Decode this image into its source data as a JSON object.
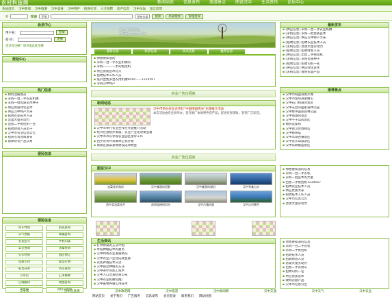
{
  "header": {
    "logo_text": "农村科技网",
    "top_nav": [
      "新闻动态",
      "信息发布",
      "旅游景点",
      "图说汉中",
      "生活资讯",
      "论坛中心"
    ],
    "sub_nav": [
      "本站首页",
      "汉中新闻",
      "汉中旅游",
      "汉中美食",
      "汉中特产",
      "招商引资",
      "人才招聘",
      "房产信息",
      "汉中论坛",
      "留言反馈"
    ]
  },
  "search": {
    "label_keyword": "搜索",
    "select_1": "不限",
    "select_2": "所有分类",
    "search_button": "搜索",
    "advanced_button": "高级搜索",
    "manage_button": "管理登录"
  },
  "login": {
    "title": "会员中心",
    "user_label": "用户名：",
    "pass_label": "密 码：",
    "login_button": "登录",
    "register_button": "注册",
    "note": "还没有注册？请点击此处注册"
  },
  "side_tabs": {
    "label": "帮助中心"
  },
  "left_news": {
    "title": "热门信息",
    "items": [
      "如何注册会员",
      "求购一台二手农业机械",
      "求购一批优质苗木种子",
      "供应优质绿化苗木",
      "供应汉中特产大米",
      "招聘农业技术人员",
      "急需大量劳动力",
      "出售二手拖拉机一台",
      "招聘财会人员若干",
      "汉中市农业信息公告",
      "招商引资项目发布",
      "南郑县农产品交易"
    ]
  },
  "left_links": {
    "title": "便民信息"
  },
  "banner": {
    "caption_1": "汉中市农科站",
    "caption_2": "农民致富的好帮手"
  },
  "main_tabs": [
    "最新信息",
    "供求信息",
    "热点信息",
    "推荐信息"
  ],
  "latest": {
    "items": [
      "你想要知道的",
      "求购一台一手农业机械的",
      "求购一一二一手的拖拉机",
      "供应优质苗木花卉",
      "招聘技术工作人员",
      "低价出售多台农用机械9016——1234567",
      "求购汉中特产",
      "招聘人员若干名"
    ]
  },
  "sep_1": "农业广告位招商",
  "news_box": {
    "title": "新闻动态",
    "more": "more",
    "headline": "汉中市举办农业合作社\"中国田园风光\"主题推介活动",
    "lead": "本次活动由农业局举办，旨在推广本地特色农产品，促进农民增收，受到广泛欢迎。",
    "items": [
      "汉中市举行农业合作社专题推介活动",
      "经济社会稳步发展，农业产业化效果显著",
      "汉中市市长参观农业园区指导工作",
      "西乡县茶叶采摘季正式开始",
      "南郑区蔬菜基地建设成效明显"
    ]
  },
  "right_box": {
    "title": "最新发布",
    "items": [
      "[供应信息] 求购一台二手农业机械",
      "[求购信息] 求购一批优质苗木",
      "[供应信息] 供应汉中特产大米",
      "[招聘信息] 招聘农业技术人员",
      "[求购信息] 急需大量劳动力",
      "[招聘信息] 招聘财会人员",
      "[供应信息] 出售二手拖拉机",
      "[求购信息] 求购优质种子",
      "[招聘信息] 招聘司机一名",
      "[供应信息] 供应绿化苗木",
      "[求购信息] 收购农副产品"
    ]
  },
  "recommend": {
    "title": "推荐景点",
    "items": [
      "汉中市城固县南沙湖",
      "汉中市留坝县紫柏山",
      "汉中石门栈道风景区",
      "汉中天台山国家森林公园",
      "汉中黎坪国家森林公园",
      "汉中南湖风景区",
      "汉中午子山风景区",
      "勉县武侯祠",
      "汉中古汉台博物馆",
      "汉中拜将坛",
      "汉中华阳古镇景区",
      "汉中龙头山旅游区",
      "汉中朱鹮梨园景区"
    ]
  },
  "sep_2": "农业广告位招商",
  "photos": {
    "title": "图说汉中",
    "more": "more",
    "captions": [
      "油菜花的海洋",
      "汉中美丽的田野",
      "汉中美丽的湖泊",
      "汉中秀美山水",
      "西乡县油菜花开",
      "南郑县梯田风光",
      "汉中古镇风貌",
      "汉中山村景色"
    ]
  },
  "right_mid": {
    "items": [
      "你想要知道的信息",
      "求购一台二手农机",
      "求购一批苗木的大量",
      "出售二手拖拉机1234567",
      "招聘农业技术人员",
      "供应优质大米",
      "招聘技术工作人员",
      "汉中市信息公告",
      "急需大量劳动力"
    ]
  },
  "left_bottom": {
    "title": "便民信息",
    "items": [
      "列车时刻",
      "航班查询",
      "天气预报",
      "邮编查询",
      "长途区号",
      "手机归属",
      "公交查询",
      "违章查询",
      "火车时刻",
      "酒店预订",
      "电视节目",
      "股票行情",
      "彩票开奖",
      "列车查询",
      "万年历",
      "汇率换算",
      "在线翻译",
      "地图查询",
      "IP查询",
      "身份证查询"
    ]
  },
  "bottom_box": {
    "title": "生活资讯",
    "more": "more",
    "items": [
      "打井修渠的方法介绍",
      "水稻种植技术的要点",
      "汉中特色农业发展情况",
      "汉中农业产业化成就显著",
      "农民养殖技术交流",
      "汉中蔬菜种植的方法",
      "汉中茶叶的加工技术",
      "汉中人口普查结果公布",
      "汉中农业机械化推广",
      "汉中畜牧养殖实用技术",
      "汉中农业发展新趋势",
      "汉中农村电商发展状况"
    ]
  },
  "right_bottom": {
    "items": [
      "你想要知道的信息",
      "求购一台二手农机",
      "求购二手拖拉机",
      "招聘技术人员",
      "招聘财会人员",
      "急需大量劳动力",
      "出售二手农用车",
      "招聘司机一名",
      "供应优质苗木",
      "收购农副产品",
      "汉中市信息公告"
    ]
  },
  "bottom_labels": [
    "汉中市",
    "汉中信息港",
    "汉中政府网",
    "汉中旅游",
    "汉中新闻网",
    "汉中交通",
    "汉中天气",
    "汉中农业"
  ],
  "footer": [
    "网站首页",
    "关于我们",
    "广告服务",
    "信息发布",
    "会员登录",
    "联系我们",
    "网站地图"
  ],
  "colors": {
    "brand_green": "#5a9a12",
    "accent_yellow": "#e3a90f",
    "border_green": "#8cc14d"
  }
}
